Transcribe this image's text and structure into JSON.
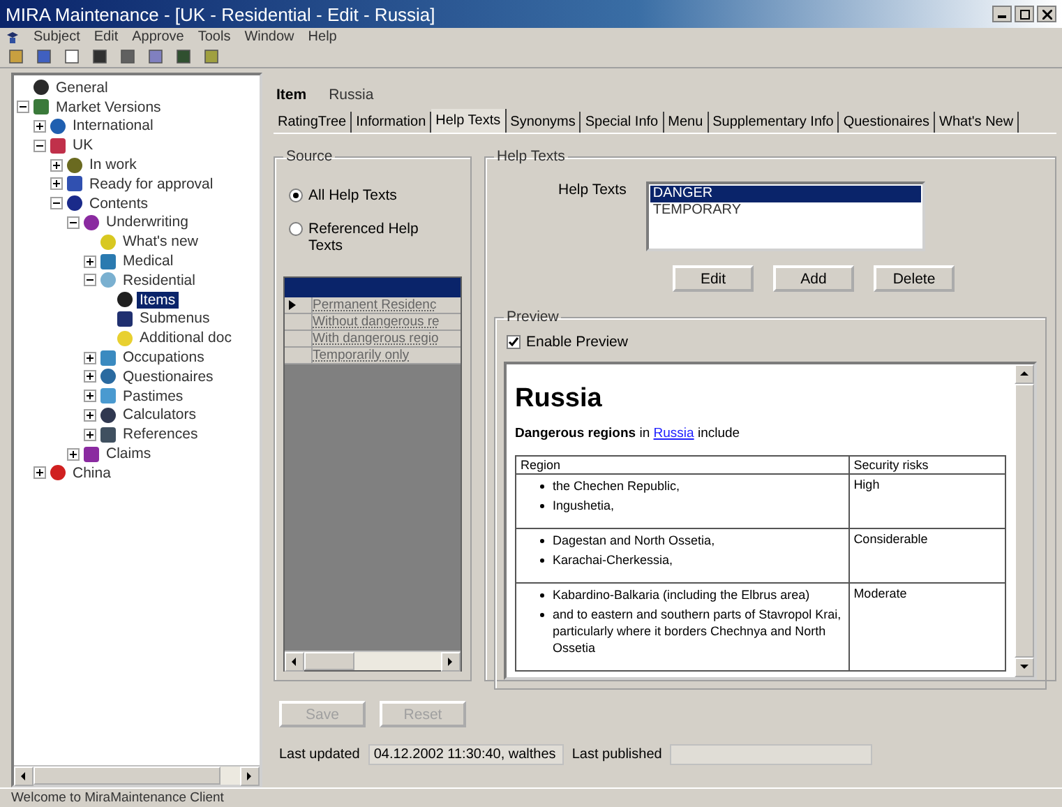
{
  "window": {
    "title": "MIRA Maintenance - [UK - Residential - Edit - Russia]"
  },
  "menu": [
    "Subject",
    "Edit",
    "Approve",
    "Tools",
    "Window",
    "Help"
  ],
  "tree": [
    {
      "label": "General",
      "color": "#2a2a2a",
      "selected": false
    },
    {
      "label": "Market Versions",
      "color": "#3a7a3a",
      "selected": false,
      "expanded": true,
      "children": [
        {
          "label": "International",
          "color": "#1f5fb0",
          "selected": false,
          "expanded": false
        },
        {
          "label": "UK",
          "color": "#c0304a",
          "selected": false,
          "expanded": true,
          "children": [
            {
              "label": "In work",
              "color": "#6a6a20",
              "selected": false,
              "expanded": false
            },
            {
              "label": "Ready for approval",
              "color": "#3050b0",
              "selected": false,
              "expanded": false
            },
            {
              "label": "Contents",
              "color": "#1a2a8a",
              "selected": false,
              "expanded": true,
              "children": [
                {
                  "label": "Underwriting",
                  "color": "#8a2aa0",
                  "selected": false,
                  "expanded": true,
                  "children": [
                    {
                      "label": "What's new",
                      "color": "#d8c820",
                      "selected": false
                    },
                    {
                      "label": "Medical",
                      "color": "#2a7ab0",
                      "selected": false,
                      "expanded": false
                    },
                    {
                      "label": "Residential",
                      "color": "#7ab0d0",
                      "selected": false,
                      "expanded": true,
                      "children": [
                        {
                          "label": "Items",
                          "color": "#202020",
                          "selected": true
                        },
                        {
                          "label": "Submenus",
                          "color": "#203070",
                          "selected": false
                        },
                        {
                          "label": "Additional doc",
                          "color": "#e8d030",
                          "selected": false
                        }
                      ]
                    },
                    {
                      "label": "Occupations",
                      "color": "#3a8ac0",
                      "selected": false,
                      "expanded": false
                    },
                    {
                      "label": "Questionaires",
                      "color": "#2a6aa0",
                      "selected": false,
                      "expanded": false
                    },
                    {
                      "label": "Pastimes",
                      "color": "#4a9ad0",
                      "selected": false,
                      "expanded": false
                    },
                    {
                      "label": "Calculators",
                      "color": "#303850",
                      "selected": false,
                      "expanded": false
                    },
                    {
                      "label": "References",
                      "color": "#405060",
                      "selected": false,
                      "expanded": false
                    }
                  ]
                },
                {
                  "label": "Claims",
                  "color": "#8a2aa0",
                  "selected": false,
                  "expanded": false
                }
              ]
            }
          ]
        },
        {
          "label": "China",
          "color": "#d02020",
          "selected": false,
          "expanded": false
        }
      ]
    }
  ],
  "item": {
    "label": "Item",
    "value": "Russia"
  },
  "tabs": [
    {
      "label": "RatingTree",
      "selected": false
    },
    {
      "label": "Information",
      "selected": false
    },
    {
      "label": "Help Texts",
      "selected": true
    },
    {
      "label": "Synonyms",
      "selected": false
    },
    {
      "label": "Special Info",
      "selected": false
    },
    {
      "label": "Menu",
      "selected": false
    },
    {
      "label": "Supplementary Info",
      "selected": false
    },
    {
      "label": "Questionaires",
      "selected": false
    },
    {
      "label": "What's New",
      "selected": false
    }
  ],
  "source": {
    "title": "Source",
    "options": [
      {
        "label": "All Help Texts",
        "selected": true
      },
      {
        "label": "Referenced Help Texts",
        "selected": false
      }
    ],
    "rows": [
      {
        "text": "Permanent Residenc",
        "current": true
      },
      {
        "text": "Without dangerous re",
        "current": false
      },
      {
        "text": "With dangerous regio",
        "current": false
      },
      {
        "text": "Temporarily only",
        "current": false
      }
    ]
  },
  "help_texts": {
    "title": "Help Texts",
    "label": "Help Texts",
    "items": [
      {
        "text": "DANGER",
        "selected": true
      },
      {
        "text": "TEMPORARY",
        "selected": false
      }
    ],
    "buttons": [
      "Edit",
      "Add",
      "Delete"
    ]
  },
  "preview": {
    "title": "Preview",
    "enable": {
      "label": "Enable Preview",
      "checked": true
    },
    "heading": "Russia",
    "intro_before": "**Dangerous regions** in ",
    "intro_link": "Russia",
    "intro_after": " include",
    "columns": [
      "Region",
      "Security risks"
    ],
    "rows": [
      {
        "regions": [
          "the Chechen Republic,",
          "Ingushetia,"
        ],
        "risk": "High"
      },
      {
        "regions": [
          "Dagestan and North Ossetia,",
          "Karachai-Cherkessia,"
        ],
        "risk": "Considerable"
      },
      {
        "regions": [
          "Kabardino-Balkaria (including the Elbrus area)",
          "and to eastern and southern parts of Stavropol Krai, particularly where it borders Chechnya and North Ossetia"
        ],
        "risk": "Moderate"
      }
    ]
  },
  "actions": [
    {
      "label": "Save",
      "disabled": true
    },
    {
      "label": "Reset",
      "disabled": true
    }
  ],
  "last_updated": {
    "label": "Last updated",
    "value": "04.12.2002 11:30:40, walthes"
  },
  "last_published": {
    "label": "Last published"
  },
  "status_bar": "Welcome to MiraMaintenance Client"
}
